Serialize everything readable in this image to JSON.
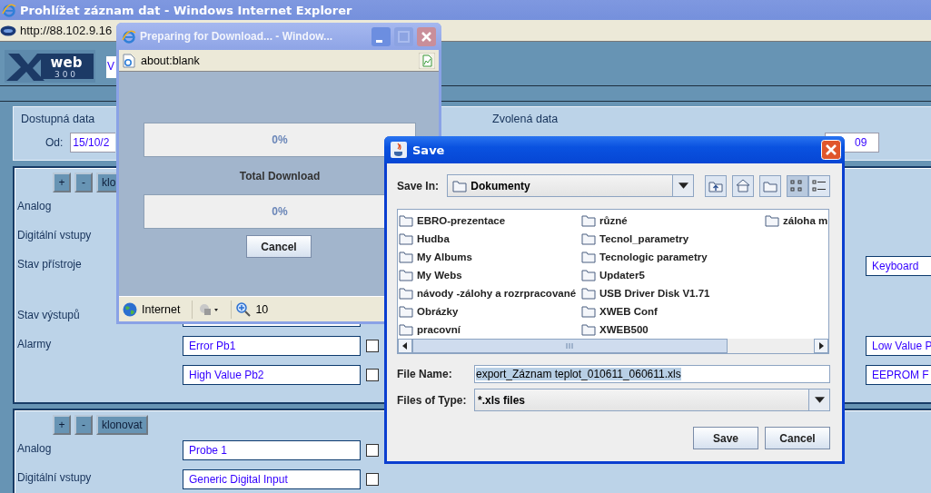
{
  "browser": {
    "title": "Prohlížet záznam dat - Windows Internet Explorer",
    "address": "http://88.102.9.16"
  },
  "page": {
    "logo": {
      "word": "web",
      "number": "300"
    },
    "top_field": "V",
    "available": {
      "title": "Dostupná data",
      "from_label": "Od:",
      "from_value": "15/10/2"
    },
    "chosen": {
      "title": "Zvolená data",
      "to_value": "09"
    },
    "sections": [
      {
        "buttons": [
          "+",
          "-",
          "klo"
        ],
        "rows": [
          {
            "label": "Analog"
          },
          {
            "label": "Digitální vstupy"
          },
          {
            "label": "Stav přístroje",
            "right_field": "Keyboard"
          },
          {
            "label": "Stav výstupů",
            "covered_field": true
          },
          {
            "label": "Alarmy",
            "field": {
              "value": "Error Pb1",
              "checked": false
            },
            "right_field": "Low Value P"
          },
          {
            "field": {
              "value": "High Value Pb2",
              "checked": false
            },
            "right_field": "EEPROM F"
          }
        ]
      },
      {
        "buttons": [
          "+",
          "-",
          "klonovat"
        ],
        "rows": [
          {
            "label": "Analog",
            "field": {
              "value": "Probe 1",
              "checked": false
            }
          },
          {
            "label": "Digitální vstupy",
            "field": {
              "value": "Generic Digital Input",
              "checked": false
            }
          }
        ]
      }
    ]
  },
  "download_window": {
    "title": "Preparing for Download... - Window...",
    "address": "about:blank",
    "progress": [
      {
        "reading": "0%",
        "level": 0
      },
      {
        "caption": "Total Download",
        "reading": "0%",
        "level": 0
      }
    ],
    "cancel": "Cancel",
    "status": {
      "zone": "Internet",
      "zoom": "10"
    }
  },
  "save_dialog": {
    "title": "Save",
    "save_in_label": "Save In:",
    "folder": "Dokumenty",
    "view_toggles": [
      {
        "selected": true
      },
      {
        "selected": false
      }
    ],
    "files": [
      "EBRO-prezentace",
      "Hudba",
      "My Albums",
      "My Webs",
      "návody -zálohy a rozrpracované",
      "Obrázky",
      "pracovní",
      "různé",
      "Tecnol_parametry",
      "Tecnologic parametry",
      "Updater5",
      "USB Driver Disk V1.71",
      "XWEB Conf",
      "XWEB500",
      "záloha m"
    ],
    "file_name_label": "File Name:",
    "file_name": "export_Záznam teplot_010611_060611.xls",
    "file_name_selected": true,
    "type_label": "Files of Type:",
    "type": "*.xls files",
    "buttons": [
      "Save",
      "Cancel"
    ]
  }
}
